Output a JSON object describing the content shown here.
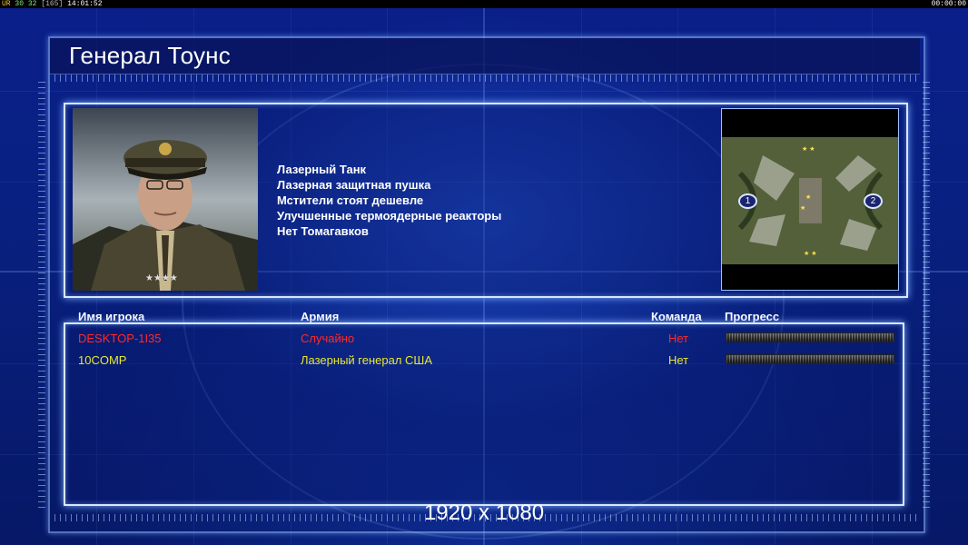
{
  "overlay": {
    "left_prefix": "UR",
    "stat_a": "30",
    "stat_b": "32",
    "stat_c": "[165]",
    "clock": "14:01:52",
    "right_timer": "00:00:00"
  },
  "header": {
    "title": "Генерал Тоунс"
  },
  "general": {
    "portrait_icon": "general-portrait",
    "features": [
      "Лазерный Танк",
      "Лазерная защитная пушка",
      "Мстители стоят дешевле",
      "Улучшенные термоядерные реакторы",
      "Нет Томагавков"
    ]
  },
  "minimap": {
    "start_positions": [
      "1",
      "2"
    ],
    "terrain_color": "#5d6240"
  },
  "players_table": {
    "columns": [
      "Имя игрока",
      "Армия",
      "Команда",
      "Прогресс"
    ],
    "rows": [
      {
        "name": "DESKTOP-1I35",
        "army": "Случайно",
        "team": "Нет",
        "color": "#ff2a2a",
        "progress": 0
      },
      {
        "name": "10COMP",
        "army": "Лазерный генерал США",
        "team": "Нет",
        "color": "#e8e830",
        "progress": 0
      }
    ]
  },
  "resolution_label": "1920 x 1080",
  "colors": {
    "background": "#061a6e",
    "panel_border": "#d8e6ff",
    "player1": "#ff2a2a",
    "player2": "#e8e830"
  }
}
